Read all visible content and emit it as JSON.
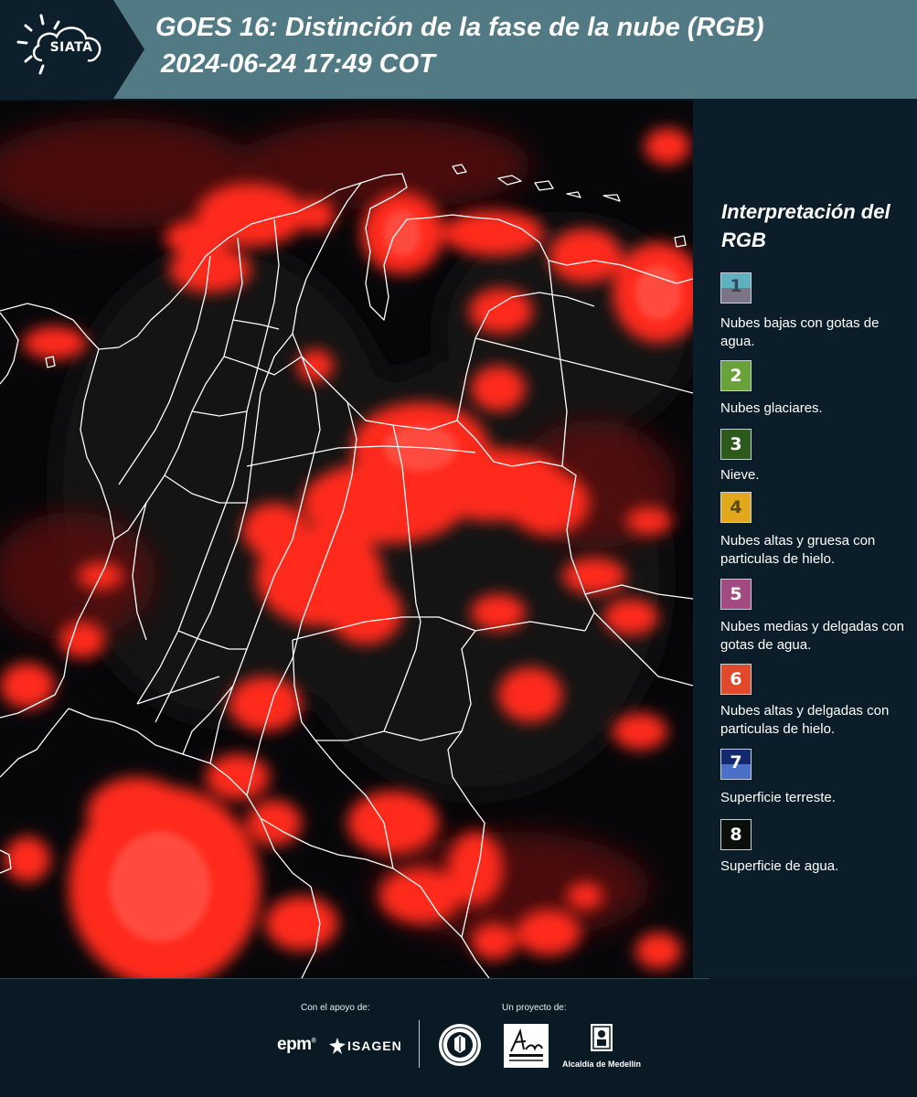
{
  "header": {
    "logo_text": "SIATA",
    "title_line1": "GOES 16: Distinción de la fase de la nube (RGB)",
    "title_line2": "2024-06-24 17:49 COT"
  },
  "legend": {
    "title": "Interpretación del RGB",
    "items": [
      {
        "number": "1",
        "label": "Nubes bajas con gotas de agua.",
        "color_top": "#5fb0c0",
        "color_bottom": "#7b7386",
        "text_color": "#3a4656"
      },
      {
        "number": "2",
        "label": "Nubes glaciares.",
        "color_top": "#6aa23a",
        "color_bottom": "#6aa23a",
        "text_color": "#ffffff"
      },
      {
        "number": "3",
        "label": "Nieve.",
        "color_top": "#2c5a1c",
        "color_bottom": "#2c5a1c",
        "text_color": "#ffffff"
      },
      {
        "number": "4",
        "label": "Nubes altas y gruesa con particulas de hielo.",
        "color_top": "#e0a81a",
        "color_bottom": "#e0a81a",
        "text_color": "#5a4a18"
      },
      {
        "number": "5",
        "label": "Nubes medias y delgadas con gotas de agua.",
        "color_top": "#a34a82",
        "color_bottom": "#a34a82",
        "text_color": "#ffffff"
      },
      {
        "number": "6",
        "label": "Nubes altas y delgadas con particulas de hielo.",
        "color_top": "#e04a2a",
        "color_bottom": "#e04a2a",
        "text_color": "#ffffff"
      },
      {
        "number": "7",
        "label": "Superficie terreste.",
        "color_top": "#14286e",
        "color_bottom": "#4a70c8",
        "text_color": "#ffffff"
      },
      {
        "number": "8",
        "label": "Superficie de agua.",
        "color_top": "#0a0f0c",
        "color_bottom": "#0a0f0c",
        "text_color": "#ffffff"
      }
    ]
  },
  "footer": {
    "support_label": "Con el apoyo de:",
    "project_label": "Un proyecto de:",
    "sponsor_epm": "epm",
    "sponsor_epm_mark": "®",
    "sponsor_isagen": "ISAGEN",
    "partner_alcaldia": "Alcaldía de Medellín"
  },
  "colors": {
    "header_bg": "#527a85",
    "panel_bg": "#0b1d28",
    "cloud_red": "#ff2a1a",
    "border_lines": "#ffffff"
  }
}
